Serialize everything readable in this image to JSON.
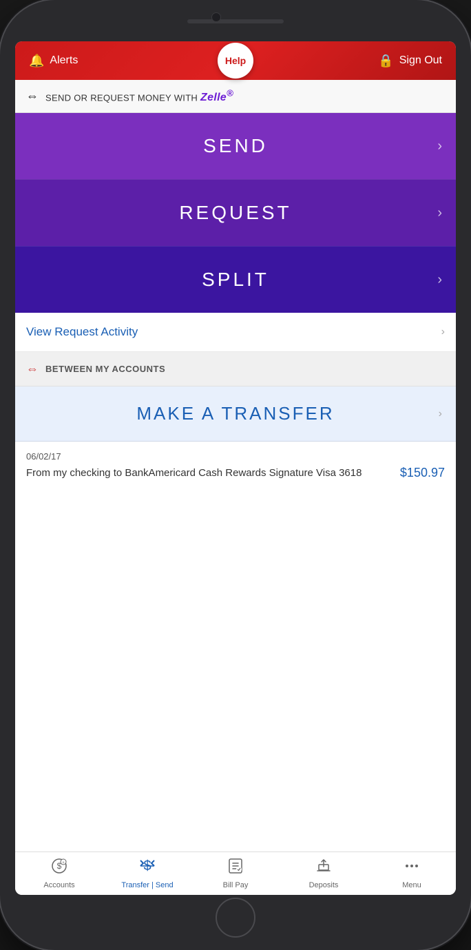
{
  "phone": {
    "header": {
      "alerts_label": "Alerts",
      "help_label": "Help",
      "signout_label": "Sign Out"
    },
    "zelle_banner": {
      "text": "SEND OR REQUEST MONEY WITH",
      "brand": "Zelle",
      "brand_symbol": "®"
    },
    "actions": {
      "send": {
        "label": "SEND"
      },
      "request": {
        "label": "REQUEST"
      },
      "split": {
        "label": "SPLIT"
      }
    },
    "view_request": {
      "label": "View Request Activity"
    },
    "between_accounts": {
      "header_label": "BETWEEN MY ACCOUNTS",
      "transfer_label": "MAKE A TRANSFER"
    },
    "transaction": {
      "date": "06/02/17",
      "description": "From my checking to BankAmericard Cash Rewards Signature Visa 3618",
      "amount": "$150.97"
    },
    "bottom_nav": {
      "items": [
        {
          "label": "Accounts",
          "active": false
        },
        {
          "label": "Transfer | Send",
          "active": true
        },
        {
          "label": "Bill Pay",
          "active": false
        },
        {
          "label": "Deposits",
          "active": false
        },
        {
          "label": "Menu",
          "active": false
        }
      ]
    }
  }
}
